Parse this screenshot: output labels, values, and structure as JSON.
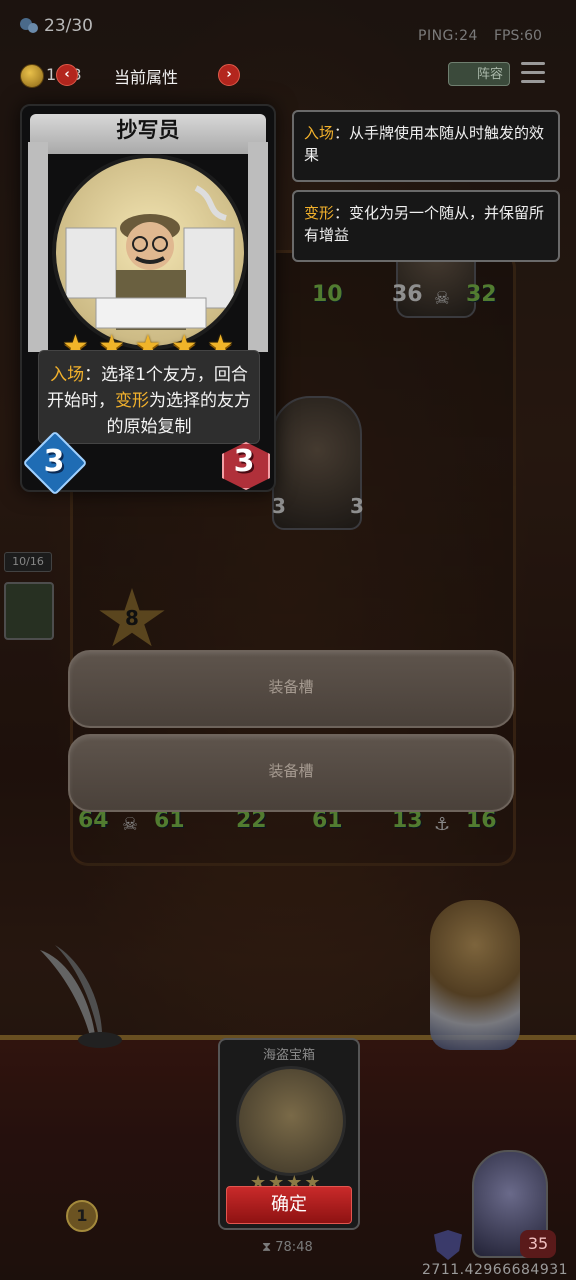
{
  "top_bar": {
    "turns": "23/30",
    "ping": "PING:24",
    "fps": "FPS:60",
    "coins": "1 13",
    "attr_label": "当前属性",
    "lineup_label": "阵容"
  },
  "card": {
    "name": "抄写员",
    "stars": 5,
    "desc_kw1": "入场",
    "desc_part1": "：选择1个友方，回合开始时，",
    "desc_kw2": "变形",
    "desc_part2": "为选择的友方的原始复制",
    "attack": "3",
    "health": "3"
  },
  "keywords": [
    {
      "name": "入场",
      "text": "：从手牌使用本随从时触发的效果"
    },
    {
      "name": "变形",
      "text": "：变化为另一个随从，并保留所有增益"
    }
  ],
  "board": {
    "top_left_stat": "10",
    "top_right_attack": "36",
    "top_right_health": "32",
    "mid_attack": "3",
    "mid_health": "3",
    "row": [
      {
        "attack": "64",
        "health": "61"
      },
      {
        "attack": "22",
        "health": "61"
      },
      {
        "attack": "13",
        "health": "16"
      }
    ],
    "side_count": "10/16",
    "star_level": "8"
  },
  "slots": [
    "装备槽",
    "装备槽"
  ],
  "bottom": {
    "chest_title": "海盗宝箱",
    "confirm": "确定",
    "timer": "78:48",
    "gold_badge": "1",
    "hero_hp": "35",
    "bottom_number": "2711.42966684931"
  },
  "colors": {
    "accent": "#f2b12c",
    "confirm": "#b71c1c",
    "attack": "#1f6cb4",
    "health": "#b0303a"
  }
}
